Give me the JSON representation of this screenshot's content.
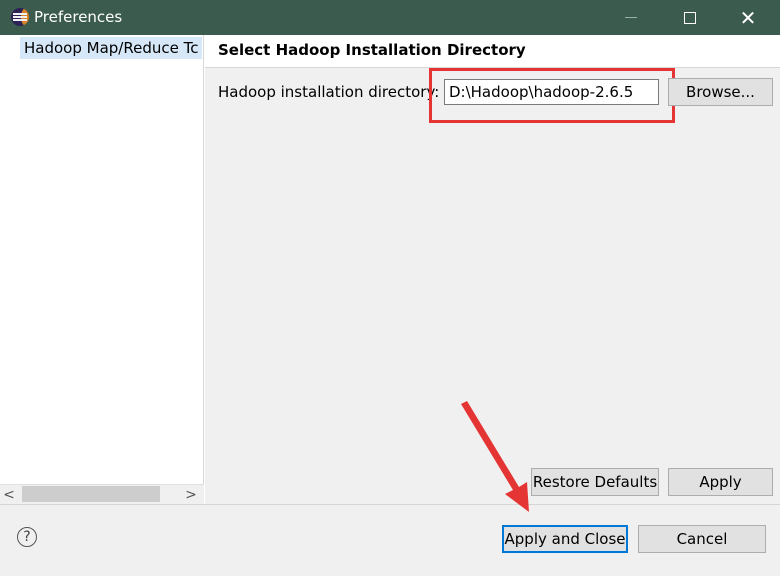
{
  "window": {
    "title": "Preferences",
    "min_glyph": "—",
    "close_glyph": "✕"
  },
  "tree": {
    "items": [
      {
        "label": "Hadoop Map/Reduce Tc"
      }
    ],
    "scroll_left": "<",
    "scroll_right": ">"
  },
  "page": {
    "title": "Select Hadoop Installation Directory",
    "dir_label": "Hadoop installation directory:",
    "dir_value": "D:\\Hadoop\\hadoop-2.6.5",
    "browse_label": "Browse...",
    "restore_label": "Restore Defaults",
    "apply_label": "Apply"
  },
  "footer": {
    "help_glyph": "?",
    "apply_close_label": "Apply and Close",
    "cancel_label": "Cancel"
  },
  "colors": {
    "titlebar": "#3c5b4f",
    "selection": "#d6e8f8",
    "annotation": "#e53434",
    "focus": "#0078d7"
  }
}
